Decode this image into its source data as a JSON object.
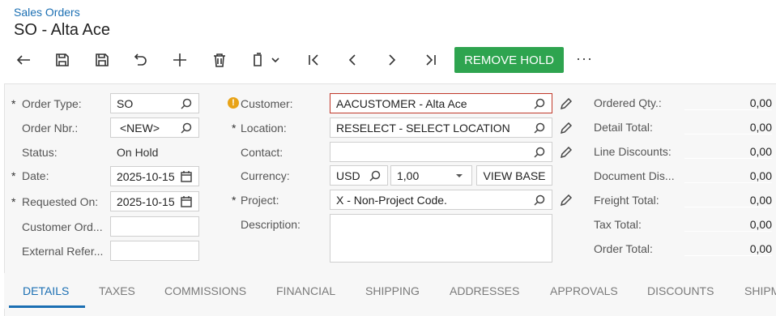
{
  "breadcrumb": "Sales Orders",
  "page_title": "SO - Alta Ace",
  "toolbar": {
    "remove_hold_label": "REMOVE HOLD",
    "more_label": "···"
  },
  "form": {
    "order_type": {
      "label": "Order Type:",
      "value": "SO"
    },
    "order_nbr": {
      "label": "Order Nbr.:",
      "value": "<NEW>"
    },
    "status": {
      "label": "Status:",
      "value": "On Hold"
    },
    "date": {
      "label": "Date:",
      "value": "2025-10-15"
    },
    "requested_on": {
      "label": "Requested On:",
      "value": "2025-10-15"
    },
    "customer_ord": {
      "label": "Customer Ord...",
      "value": ""
    },
    "external_ref": {
      "label": "External Refer...",
      "value": ""
    },
    "customer": {
      "label": "Customer:",
      "value": "AACUSTOMER - Alta Ace"
    },
    "location": {
      "label": "Location:",
      "value": "RESELECT - SELECT LOCATION"
    },
    "contact": {
      "label": "Contact:",
      "value": ""
    },
    "currency": {
      "label": "Currency:",
      "value": "USD",
      "rate": "1,00",
      "view_base_label": "VIEW BASE"
    },
    "project": {
      "label": "Project:",
      "value": "X - Non-Project Code."
    },
    "description": {
      "label": "Description:",
      "value": ""
    }
  },
  "totals": [
    {
      "label": "Ordered Qty.:",
      "value": "0,00"
    },
    {
      "label": "Detail Total:",
      "value": "0,00"
    },
    {
      "label": "Line Discounts:",
      "value": "0,00"
    },
    {
      "label": "Document Dis...",
      "value": "0,00"
    },
    {
      "label": "Freight Total:",
      "value": "0,00"
    },
    {
      "label": "Tax Total:",
      "value": "0,00"
    },
    {
      "label": "Order Total:",
      "value": "0,00"
    }
  ],
  "tabs": [
    "DETAILS",
    "TAXES",
    "COMMISSIONS",
    "FINANCIAL",
    "SHIPPING",
    "ADDRESSES",
    "APPROVALS",
    "DISCOUNTS",
    "SHIPM"
  ],
  "colors": {
    "accent": "#1b6fb3",
    "success": "#2ea44f",
    "warning": "#e8a317",
    "error": "#c0392b"
  }
}
